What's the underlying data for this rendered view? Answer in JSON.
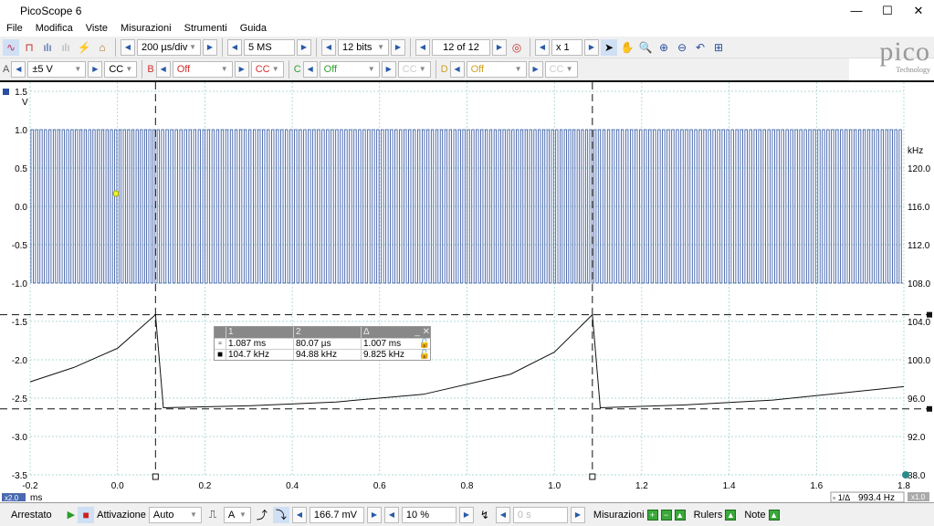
{
  "window": {
    "title": "PicoScope 6",
    "minimize": "—",
    "maximize": "☐",
    "close": "✕"
  },
  "menu": [
    "File",
    "Modifica",
    "Viste",
    "Misurazioni",
    "Strumenti",
    "Guida"
  ],
  "toolbar": {
    "timebase": "200 µs/div",
    "samples": "5 MS",
    "resolution": "12 bits",
    "buffer": "12 of 12",
    "zoom": "x 1"
  },
  "channels": [
    {
      "name": "A",
      "range": "±5 V",
      "coupling": "CC",
      "color": "#555555"
    },
    {
      "name": "B",
      "range": "Off",
      "coupling": "CC",
      "color": "#d03030"
    },
    {
      "name": "C",
      "range": "Off",
      "coupling": "CC",
      "color": "#30a030"
    },
    {
      "name": "D",
      "range": "Off",
      "coupling": "CC",
      "color": "#d0a020"
    }
  ],
  "logo": {
    "name": "pico",
    "sub": "Technology"
  },
  "plot": {
    "left_unit": "V",
    "right_unit": "kHz",
    "x_unit": "ms",
    "x_zoom": "x2.0",
    "y_zoom": "x1.0",
    "left_ticks": [
      "1.5",
      "1.0",
      "0.5",
      "0.0",
      "-0.5",
      "-1.0",
      "-1.5",
      "-2.0",
      "-2.5",
      "-3.0",
      "-3.5"
    ],
    "right_ticks": [
      "120.0",
      "116.0",
      "112.0",
      "108.0",
      "104.0",
      "100.0",
      "96.0",
      "92.0",
      "88.0"
    ],
    "x_ticks": [
      "-0.2",
      "0.0",
      "0.2",
      "0.4",
      "0.6",
      "0.8",
      "1.0",
      "1.2",
      "1.4",
      "1.6",
      "1.8"
    ],
    "frequency_readout": "993.4 Hz",
    "signal_color": "#2a4ea0"
  },
  "chart_data": {
    "type": "line",
    "xlim": [
      -0.2,
      1.8
    ],
    "ylim_left": [
      -3.5,
      1.5
    ],
    "ylim_right": [
      88,
      120
    ],
    "series": [
      {
        "axis": "left",
        "kind": "square wave",
        "high": 1.0,
        "low": -1.0
      },
      {
        "axis": "right",
        "x": [
          -0.2,
          -0.1,
          0.0,
          0.087,
          0.105,
          0.3,
          0.5,
          0.7,
          0.9,
          1.0,
          1.087,
          1.105,
          1.3,
          1.5,
          1.8
        ],
        "y": [
          97.7,
          99.2,
          101.2,
          104.7,
          95.0,
          95.2,
          95.6,
          96.4,
          98.5,
          100.8,
          104.7,
          95.0,
          95.3,
          95.8,
          97.2
        ]
      }
    ],
    "rulers": {
      "vertical": [
        0.087,
        1.087
      ],
      "horizontal": [
        104.7,
        94.88
      ]
    }
  },
  "measurements": {
    "headers": [
      "1",
      "2",
      "Δ"
    ],
    "rows": [
      [
        "1.087 ms",
        "80.07 µs",
        "1.007 ms"
      ],
      [
        "104.7 kHz",
        "94.88 kHz",
        "9.825 kHz"
      ]
    ]
  },
  "status": {
    "state": "Arrestato",
    "trigger_label": "Attivazione",
    "trigger_mode": "Auto",
    "trigger_source": "A",
    "threshold": "166.7 mV",
    "pretrigger": "10 %",
    "delay": "0 s",
    "measurements": "Misurazioni",
    "rulers": "Rulers",
    "notes": "Note"
  }
}
